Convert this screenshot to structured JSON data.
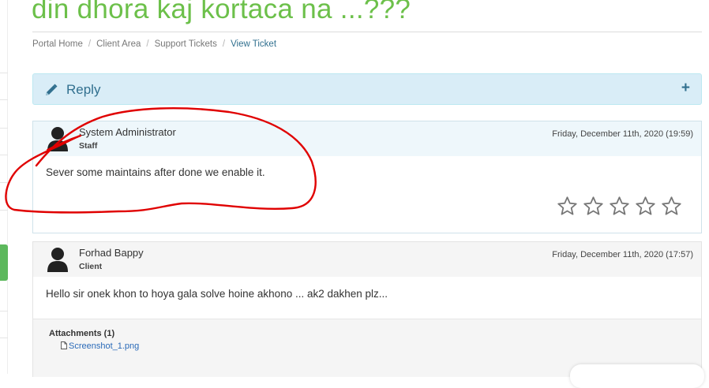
{
  "page": {
    "title": "din dhora kaj kortaca na ...???",
    "accent_color": "#6cc04a"
  },
  "breadcrumb": {
    "items": [
      "Portal Home",
      "Client Area",
      "Support Tickets"
    ],
    "active": "View Ticket"
  },
  "reply": {
    "label": "Reply",
    "icon": "pencil-icon",
    "expand_symbol": "+"
  },
  "messages": [
    {
      "author": "System Administrator",
      "role": "Staff",
      "date": "Friday, December 11th, 2020 (19:59)",
      "body": "Sever some maintains after done we enable it.",
      "rating_stars": 5,
      "rating_value": 0
    },
    {
      "author": "Forhad Bappy",
      "role": "Client",
      "date": "Friday, December 11th, 2020 (17:57)",
      "body": "Hello sir onek khon to hoya gala solve hoine akhono ... ak2 dakhen plz...",
      "attachments_label": "Attachments (1)",
      "attachments": [
        "Screenshot_1.png"
      ]
    }
  ],
  "colors": {
    "annotation_stroke": "#e00000",
    "reply_panel_bg": "#d9edf7",
    "reply_text": "#31708f"
  }
}
